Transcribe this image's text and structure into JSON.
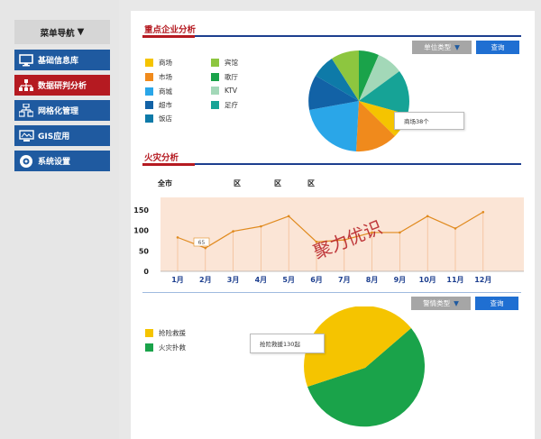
{
  "sidebar": {
    "header": "菜单导航",
    "items": [
      {
        "label": "基础信息库",
        "icon": "monitor-icon"
      },
      {
        "label": "数据研判分析",
        "icon": "org-chart-icon"
      },
      {
        "label": "网格化管理",
        "icon": "grid-network-icon"
      },
      {
        "label": "GIS应用",
        "icon": "map-screen-icon"
      },
      {
        "label": "系统设置",
        "icon": "settings-icon"
      }
    ],
    "active_index": 1,
    "colors": {
      "blue": "#1f5aa0",
      "red": "#b51a21"
    }
  },
  "enterprise": {
    "title": "重点企业分析",
    "unit_type_button": "单位类型",
    "query_button": "查询",
    "tooltip": "商场38个",
    "legend": [
      {
        "label": "商场",
        "color": "#f5c400"
      },
      {
        "label": "市场",
        "color": "#f08a1c"
      },
      {
        "label": "商城",
        "color": "#2aa6e8"
      },
      {
        "label": "超市",
        "color": "#1262a6"
      },
      {
        "label": "饭店",
        "color": "#0e7aa8"
      },
      {
        "label": "宾馆",
        "color": "#8dc63f"
      },
      {
        "label": "歌厅",
        "color": "#1aa34a"
      },
      {
        "label": "KTV",
        "color": "#a3d8b8"
      },
      {
        "label": "足疗",
        "color": "#16a396"
      }
    ]
  },
  "fire": {
    "title": "火灾分析",
    "filters": [
      "全市",
      "区",
      "区",
      "区"
    ],
    "watermark": "聚力优识",
    "point_label": "65",
    "chart_data": {
      "type": "line",
      "categories": [
        "1月",
        "2月",
        "3月",
        "4月",
        "5月",
        "6月",
        "7月",
        "8月",
        "9月",
        "10月",
        "11月",
        "12月"
      ],
      "series": [
        {
          "values": [
            83,
            57,
            98,
            110,
            135,
            72,
            77,
            95,
            95,
            135,
            105,
            145
          ]
        }
      ],
      "yticks": [
        0,
        50,
        100,
        150
      ],
      "ylim": [
        0,
        150
      ],
      "color": "#e08a1e"
    }
  },
  "alarm": {
    "type_button": "警情类型",
    "query_button": "查询",
    "tooltip": "抢险救援130起",
    "legend": [
      {
        "label": "抢险救援",
        "color": "#f5c400"
      },
      {
        "label": "火灾扑救",
        "color": "#1aa34a"
      }
    ]
  }
}
